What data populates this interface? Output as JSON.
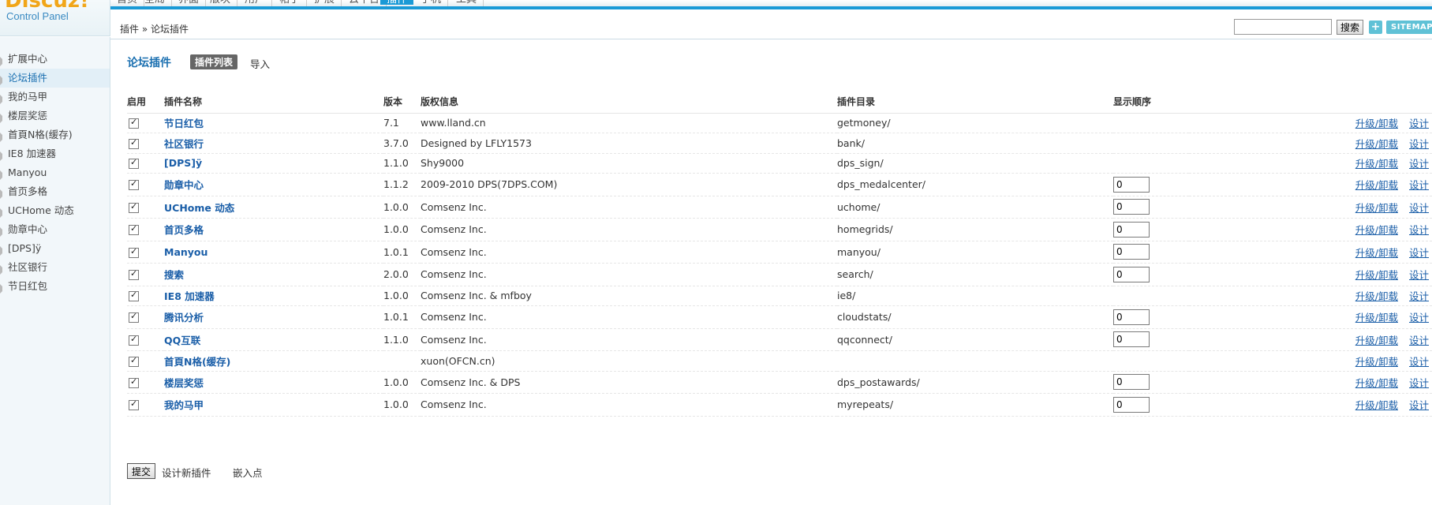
{
  "logo": {
    "brand": "Discuz!",
    "subtitle": "Control Panel"
  },
  "topnav": {
    "items": [
      "首页",
      "全局",
      "界面",
      "版块",
      "用户",
      "帖子",
      "扩展",
      "云平台",
      "插件",
      "手机",
      "工具"
    ],
    "active": "插件"
  },
  "breadcrumb": "插件 » 论坛插件",
  "search": {
    "button": "搜索",
    "value": ""
  },
  "header_buttons": {
    "plus": "+",
    "sitemap": "SITEMAP"
  },
  "sidebar": {
    "items": [
      {
        "label": "扩展中心"
      },
      {
        "label": "论坛插件",
        "active": true
      },
      {
        "label": "我的马甲"
      },
      {
        "label": "楼层奖惩"
      },
      {
        "label": "首頁N格(缓存)"
      },
      {
        "label": "IE8 加速器"
      },
      {
        "label": "Manyou"
      },
      {
        "label": "首页多格"
      },
      {
        "label": "UCHome 动态"
      },
      {
        "label": "勋章中心"
      },
      {
        "label": "[DPS]ÿ"
      },
      {
        "label": "社区银行"
      },
      {
        "label": "节日红包"
      }
    ]
  },
  "main": {
    "title": "论坛插件",
    "tabs": {
      "list": "插件列表",
      "import": "导入"
    },
    "columns": {
      "enable": "启用",
      "name": "插件名称",
      "version": "版本",
      "copyright": "版权信息",
      "dir": "插件目录",
      "order": "显示顺序"
    },
    "ops": {
      "upgrade": "升级/卸载",
      "design": "设计"
    },
    "rows": [
      {
        "name": "节日红包",
        "version": "7.1",
        "copyright": "www.lland.cn",
        "dir": "getmoney/",
        "order": null
      },
      {
        "name": "社区银行",
        "version": "3.7.0",
        "copyright": "Designed by LFLY1573",
        "dir": "bank/",
        "order": null
      },
      {
        "name": "[DPS]ÿ",
        "version": "1.1.0",
        "copyright": "Shy9000",
        "dir": "dps_sign/",
        "order": null
      },
      {
        "name": "勋章中心",
        "version": "1.1.2",
        "copyright": "2009-2010 DPS(7DPS.COM)",
        "dir": "dps_medalcenter/",
        "order": "0"
      },
      {
        "name": "UCHome 动态",
        "version": "1.0.0",
        "copyright": "Comsenz Inc.",
        "dir": "uchome/",
        "order": "0"
      },
      {
        "name": "首页多格",
        "version": "1.0.0",
        "copyright": "Comsenz Inc.",
        "dir": "homegrids/",
        "order": "0"
      },
      {
        "name": "Manyou",
        "version": "1.0.1",
        "copyright": "Comsenz Inc.",
        "dir": "manyou/",
        "order": "0"
      },
      {
        "name": "搜索",
        "version": "2.0.0",
        "copyright": "Comsenz Inc.",
        "dir": "search/",
        "order": "0"
      },
      {
        "name": "IE8 加速器",
        "version": "1.0.0",
        "copyright": "Comsenz Inc. & mfboy",
        "dir": "ie8/",
        "order": null
      },
      {
        "name": "腾讯分析",
        "version": "1.0.1",
        "copyright": "Comsenz Inc.",
        "dir": "cloudstats/",
        "order": "0"
      },
      {
        "name": "QQ互联",
        "version": "1.1.0",
        "copyright": "Comsenz Inc.",
        "dir": "qqconnect/",
        "order": "0"
      },
      {
        "name": "首頁N格(缓存)",
        "version": "",
        "copyright": "xuon(OFCN.cn)",
        "dir": "",
        "order": null
      },
      {
        "name": "楼层奖惩",
        "version": "1.0.0",
        "copyright": "Comsenz Inc. & DPS",
        "dir": "dps_postawards/",
        "order": "0"
      },
      {
        "name": "我的马甲",
        "version": "1.0.0",
        "copyright": "Comsenz Inc.",
        "dir": "myrepeats/",
        "order": "0"
      }
    ],
    "footer": {
      "submit": "提交",
      "design_new": "设计新插件",
      "embed": "嵌入点"
    }
  },
  "colors": {
    "accent": "#1a9ad6",
    "link": "#1a5ea8",
    "brand": "#f1a619"
  }
}
